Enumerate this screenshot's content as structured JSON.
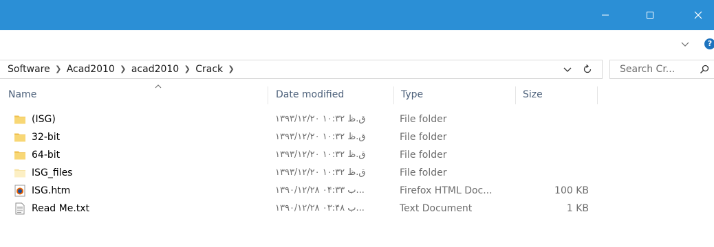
{
  "titlebar": {
    "minimize_label": "Minimize",
    "maximize_label": "Maximize",
    "close_label": "Close",
    "color": "#2b8fd6"
  },
  "ribbon": {
    "expand_icon": "chevron-down-icon",
    "help_label": "?"
  },
  "address": {
    "crumbs": [
      "Software",
      "Acad2010",
      "acad2010",
      "Crack"
    ],
    "dropdown_icon": "chevron-down-icon",
    "refresh_icon": "refresh-icon"
  },
  "search": {
    "placeholder": "Search Cr...",
    "icon": "search-icon"
  },
  "columns": {
    "name": "Name",
    "date_modified": "Date modified",
    "type": "Type",
    "size": "Size",
    "sort": "ascending"
  },
  "files": [
    {
      "name": "(ISG)",
      "date": "۱۳۹۳/۱۲/۲۰ ق.ظ ۱۰:۳۲",
      "type": "File folder",
      "size": "",
      "icon": "folder-icon"
    },
    {
      "name": "32-bit",
      "date": "۱۳۹۳/۱۲/۲۰ ق.ظ ۱۰:۳۲",
      "type": "File folder",
      "size": "",
      "icon": "folder-icon"
    },
    {
      "name": "64-bit",
      "date": "۱۳۹۳/۱۲/۲۰ ق.ظ ۱۰:۳۲",
      "type": "File folder",
      "size": "",
      "icon": "folder-icon"
    },
    {
      "name": "ISG_files",
      "date": "۱۳۹۳/۱۲/۲۰ ق.ظ ۱۰:۳۲",
      "type": "File folder",
      "size": "",
      "icon": "folder-light-icon"
    },
    {
      "name": "ISG.htm",
      "date": "۱۳۹۰/۱۲/۲۸ ب ۰۴:۳۳...",
      "type": "Firefox HTML Doc...",
      "size": "100 KB",
      "icon": "firefox-icon"
    },
    {
      "name": "Read Me.txt",
      "date": "۱۳۹۰/۱۲/۲۸ ب ۰۳:۴۸...",
      "type": "Text Document",
      "size": "1 KB",
      "icon": "text-document-icon"
    }
  ]
}
